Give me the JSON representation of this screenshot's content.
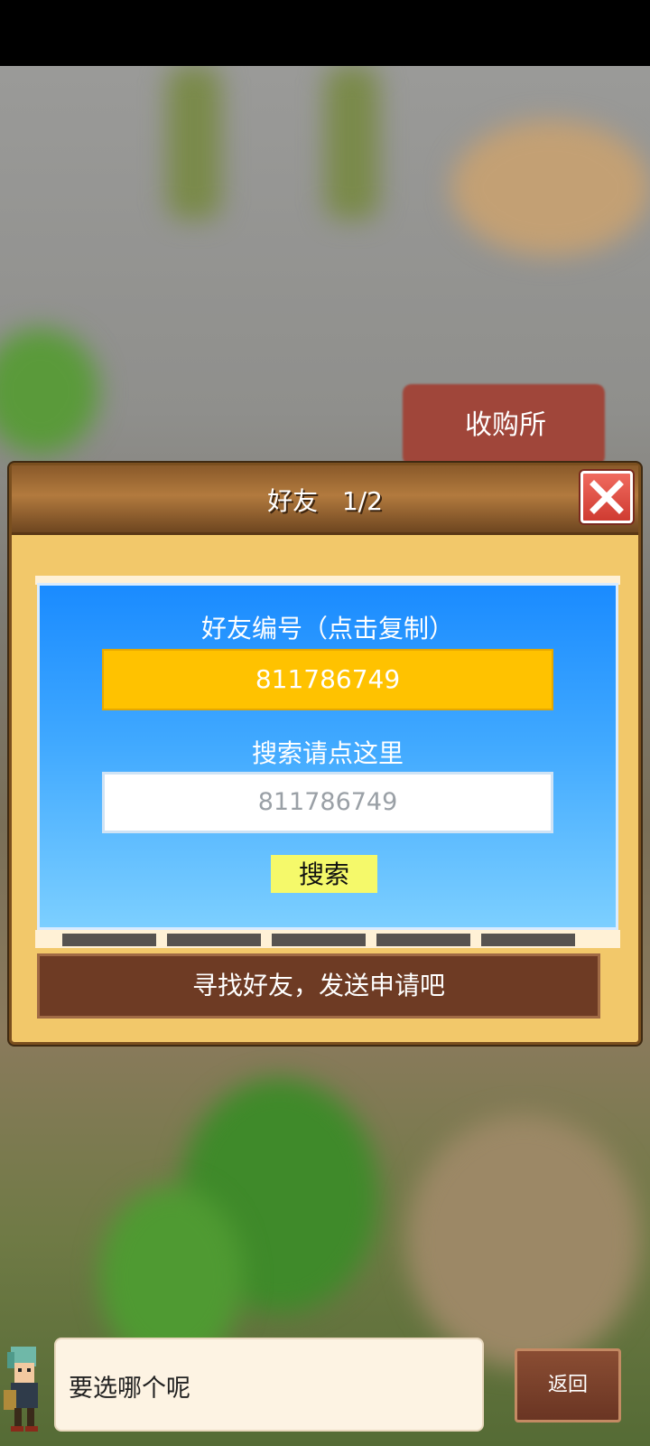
{
  "background": {
    "shop_sign": "收购所"
  },
  "dialog": {
    "title": "好友",
    "page": "1/2",
    "friend_id_label": "好友编号（点击复制）",
    "friend_id": "811786749",
    "search_hint": "搜索请点这里",
    "search_input_value": "811786749",
    "search_button": "搜索",
    "find_friends_label": "寻找好友，发送申请吧"
  },
  "bottom": {
    "speech": "要选哪个呢",
    "back_button": "返回"
  },
  "colors": {
    "dialog_bg": "#f2c86a",
    "header_brown": "#8a5a2a",
    "blue_panel": "#1a8bff",
    "id_box": "#ffc200",
    "search_button": "#f5f96a",
    "close_red": "#e04a3f"
  },
  "icons": {
    "close": "close-icon",
    "left_arrow": "chevron-left-icon",
    "right_arrow": "chevron-right-icon"
  }
}
